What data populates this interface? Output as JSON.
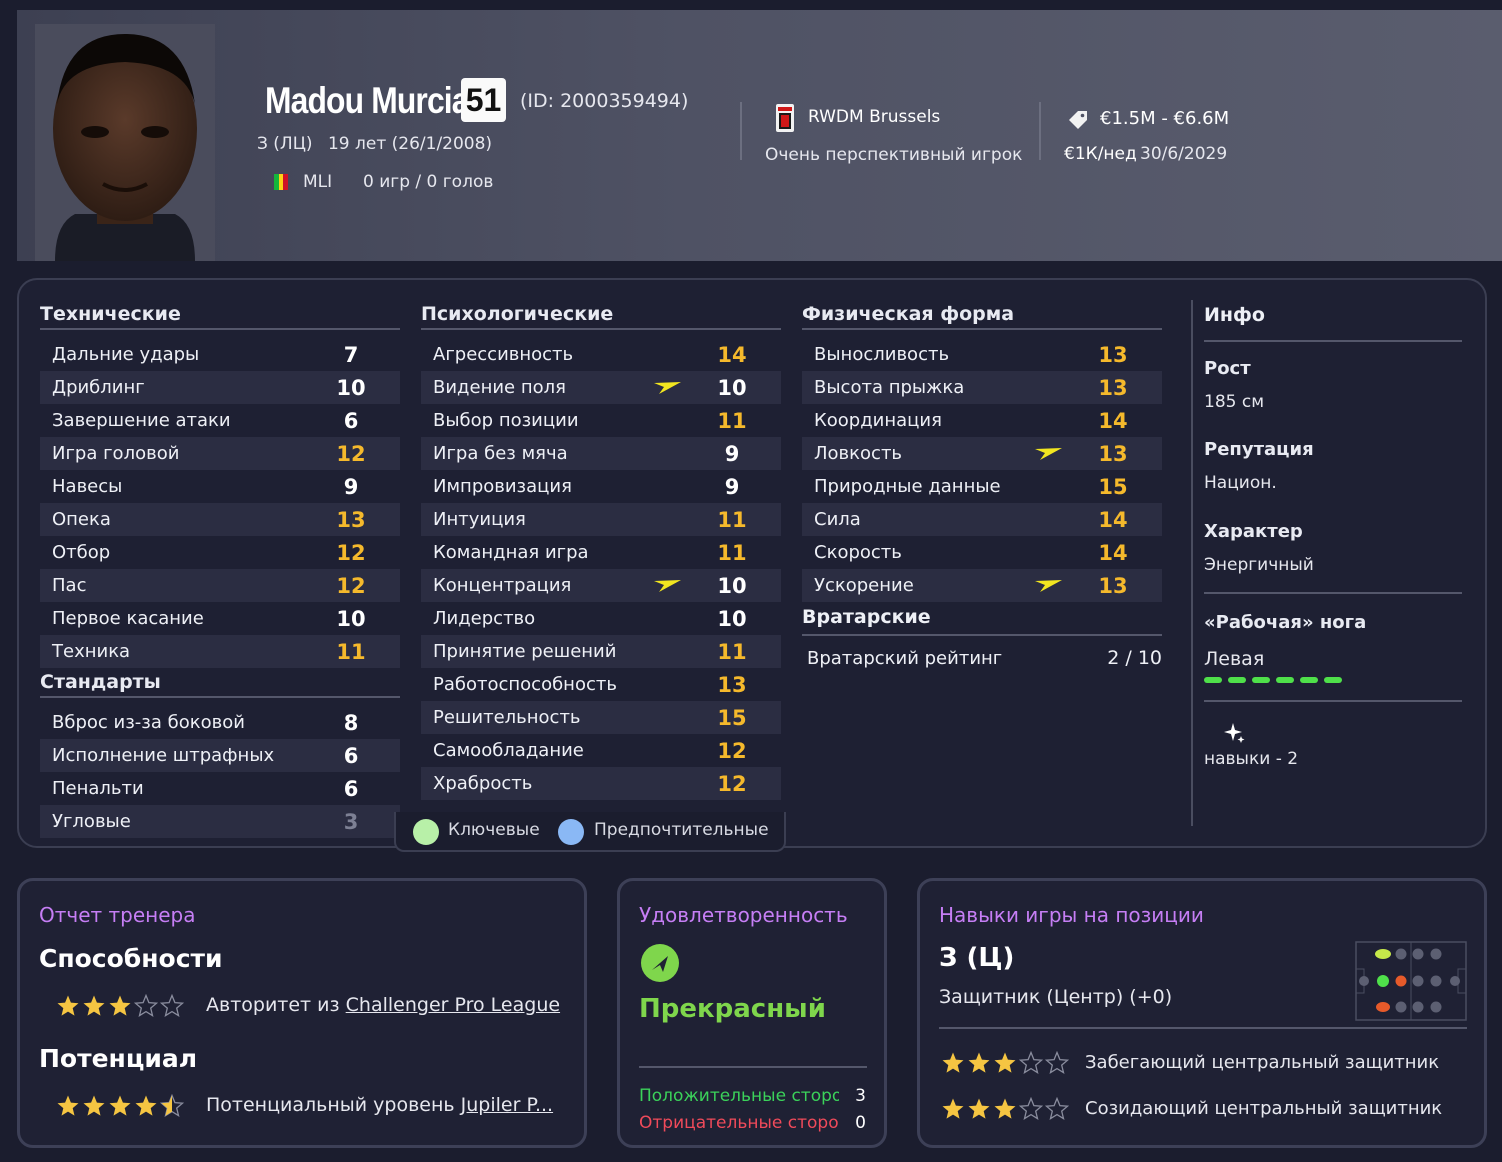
{
  "header": {
    "name": "Madou Murcia",
    "ca": "51",
    "player_id": "(ID: 2000359494)",
    "position": "З (ЛЦ)",
    "age": "19 лет (26/1/2008)",
    "nationality": "MLI",
    "apps_goals": "0 игр / 0 голов",
    "club": "RWDM Brussels",
    "prospect": "Очень перспективный игрок",
    "value": "€1.5M - €6.6M",
    "wage": "€1К/нед",
    "contract_end": "30/6/2029",
    "flag_colors": [
      "#14b53a",
      "#fcd116",
      "#ce1126"
    ]
  },
  "technical": {
    "title": "Технические",
    "rows": [
      {
        "label": "Дальние удары",
        "value": "7",
        "color": "white",
        "arrow": false
      },
      {
        "label": "Дриблинг",
        "value": "10",
        "color": "white",
        "arrow": false
      },
      {
        "label": "Завершение атаки",
        "value": "6",
        "color": "white",
        "arrow": false
      },
      {
        "label": "Игра головой",
        "value": "12",
        "color": "orange",
        "arrow": false
      },
      {
        "label": "Навесы",
        "value": "9",
        "color": "white",
        "arrow": false
      },
      {
        "label": "Опека",
        "value": "13",
        "color": "orange",
        "arrow": false
      },
      {
        "label": "Отбор",
        "value": "12",
        "color": "orange",
        "arrow": false
      },
      {
        "label": "Пас",
        "value": "12",
        "color": "orange",
        "arrow": false
      },
      {
        "label": "Первое касание",
        "value": "10",
        "color": "white",
        "arrow": false
      },
      {
        "label": "Техника",
        "value": "11",
        "color": "orange",
        "arrow": false
      }
    ]
  },
  "set_pieces": {
    "title": "Стандарты",
    "rows": [
      {
        "label": "Вброс из-за боковой",
        "value": "8",
        "color": "white"
      },
      {
        "label": "Исполнение штрафных",
        "value": "6",
        "color": "white"
      },
      {
        "label": "Пенальти",
        "value": "6",
        "color": "white"
      },
      {
        "label": "Угловые",
        "value": "3",
        "color": "gray"
      }
    ]
  },
  "mental": {
    "title": "Психологические",
    "rows": [
      {
        "label": "Агрессивность",
        "value": "14",
        "color": "orange",
        "arrow": false
      },
      {
        "label": "Видение поля",
        "value": "10",
        "color": "white",
        "arrow": true
      },
      {
        "label": "Выбор позиции",
        "value": "11",
        "color": "orange",
        "arrow": false
      },
      {
        "label": "Игра без мяча",
        "value": "9",
        "color": "white",
        "arrow": false
      },
      {
        "label": "Импровизация",
        "value": "9",
        "color": "white",
        "arrow": false
      },
      {
        "label": "Интуиция",
        "value": "11",
        "color": "orange",
        "arrow": false
      },
      {
        "label": "Командная игра",
        "value": "11",
        "color": "orange",
        "arrow": false
      },
      {
        "label": "Концентрация",
        "value": "10",
        "color": "white",
        "arrow": true
      },
      {
        "label": "Лидерство",
        "value": "10",
        "color": "white",
        "arrow": false
      },
      {
        "label": "Принятие решений",
        "value": "11",
        "color": "orange",
        "arrow": false
      },
      {
        "label": "Работоспособность",
        "value": "13",
        "color": "orange",
        "arrow": false
      },
      {
        "label": "Решительность",
        "value": "15",
        "color": "orange",
        "arrow": false
      },
      {
        "label": "Самообладание",
        "value": "12",
        "color": "orange",
        "arrow": false
      },
      {
        "label": "Храбрость",
        "value": "12",
        "color": "orange",
        "arrow": false
      }
    ]
  },
  "physical": {
    "title": "Физическая форма",
    "rows": [
      {
        "label": "Выносливость",
        "value": "13",
        "color": "orange",
        "arrow": false
      },
      {
        "label": "Высота прыжка",
        "value": "13",
        "color": "orange",
        "arrow": false
      },
      {
        "label": "Координация",
        "value": "14",
        "color": "orange",
        "arrow": false
      },
      {
        "label": "Ловкость",
        "value": "13",
        "color": "orange",
        "arrow": true
      },
      {
        "label": "Природные данные",
        "value": "15",
        "color": "orange",
        "arrow": false
      },
      {
        "label": "Сила",
        "value": "14",
        "color": "orange",
        "arrow": false
      },
      {
        "label": "Скорость",
        "value": "14",
        "color": "orange",
        "arrow": false
      },
      {
        "label": "Ускорение",
        "value": "13",
        "color": "orange",
        "arrow": true
      }
    ]
  },
  "goalkeeping": {
    "title": "Вратарские",
    "label": "Вратарский рейтинг",
    "value": "2 / 10"
  },
  "legend": {
    "key": "Ключевые",
    "preferred": "Предпочтительные",
    "key_color": "#b8f0a8",
    "preferred_color": "#8ab8f5"
  },
  "info": {
    "title": "Инфо",
    "height_label": "Рост",
    "height_value": "185 см",
    "reputation_label": "Репутация",
    "reputation_value": "Национ.",
    "personality_label": "Характер",
    "personality_value": "Энергичный",
    "foot_label": "«Рабочая» нога",
    "foot_value": "Левая",
    "traits": "навыки - 2"
  },
  "coach_report": {
    "title": "Отчет тренера",
    "ability_label": "Способности",
    "ability_stars": 3,
    "ability_text_prefix": "Авторитет из ",
    "ability_text_link": "Challenger Pro League",
    "potential_label": "Потенциал",
    "potential_stars": 4.5,
    "potential_text_prefix": "Потенциальный уровень ",
    "potential_text_link": "Jupiler P..."
  },
  "happiness": {
    "title": "Удовлетворенность",
    "status": "Прекрасный",
    "positive_label": "Положительные сторо...",
    "positive_count": "3",
    "negative_label": "Отрицательные сторо...",
    "negative_count": "0"
  },
  "position_skills": {
    "title": "Навыки игры на позиции",
    "position": "З (Ц)",
    "description": "Защитник (Центр) (+0)",
    "roles": [
      {
        "label": "Забегающий центральный защитник",
        "stars": 3
      },
      {
        "label": "Созидающий центральный защитник",
        "stars": 3
      }
    ]
  }
}
